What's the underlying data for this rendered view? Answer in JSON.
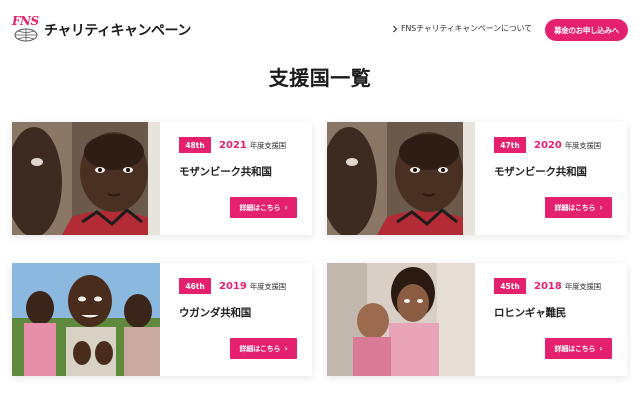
{
  "header": {
    "logo_mark": "FNS",
    "logo_text": "チャリティキャンペーン",
    "about_link": "FNSチャリティキャンペーンについて",
    "donate_button": "募金のお申し込みへ"
  },
  "page_title": "支援国一覧",
  "cards": [
    {
      "number": "48th",
      "year": "2021",
      "year_suffix": "年度支援国",
      "country": "モザンビーク共和国",
      "button": "詳細はこちら",
      "arrow": "›"
    },
    {
      "number": "47th",
      "year": "2020",
      "year_suffix": "年度支援国",
      "country": "モザンビーク共和国",
      "button": "詳細はこちら",
      "arrow": "›"
    },
    {
      "number": "46th",
      "year": "2019",
      "year_suffix": "年度支援国",
      "country": "ウガンダ共和国",
      "button": "詳細はこちら",
      "arrow": "›"
    },
    {
      "number": "45th",
      "year": "2018",
      "year_suffix": "年度支援国",
      "country": "ロヒンギャ難民",
      "button": "詳細はこちら",
      "arrow": "›"
    }
  ],
  "colors": {
    "accent": "#e5206e",
    "text": "#222222"
  },
  "icons": {
    "about_link": "chevron-right-icon",
    "logo": "globe-icon"
  }
}
